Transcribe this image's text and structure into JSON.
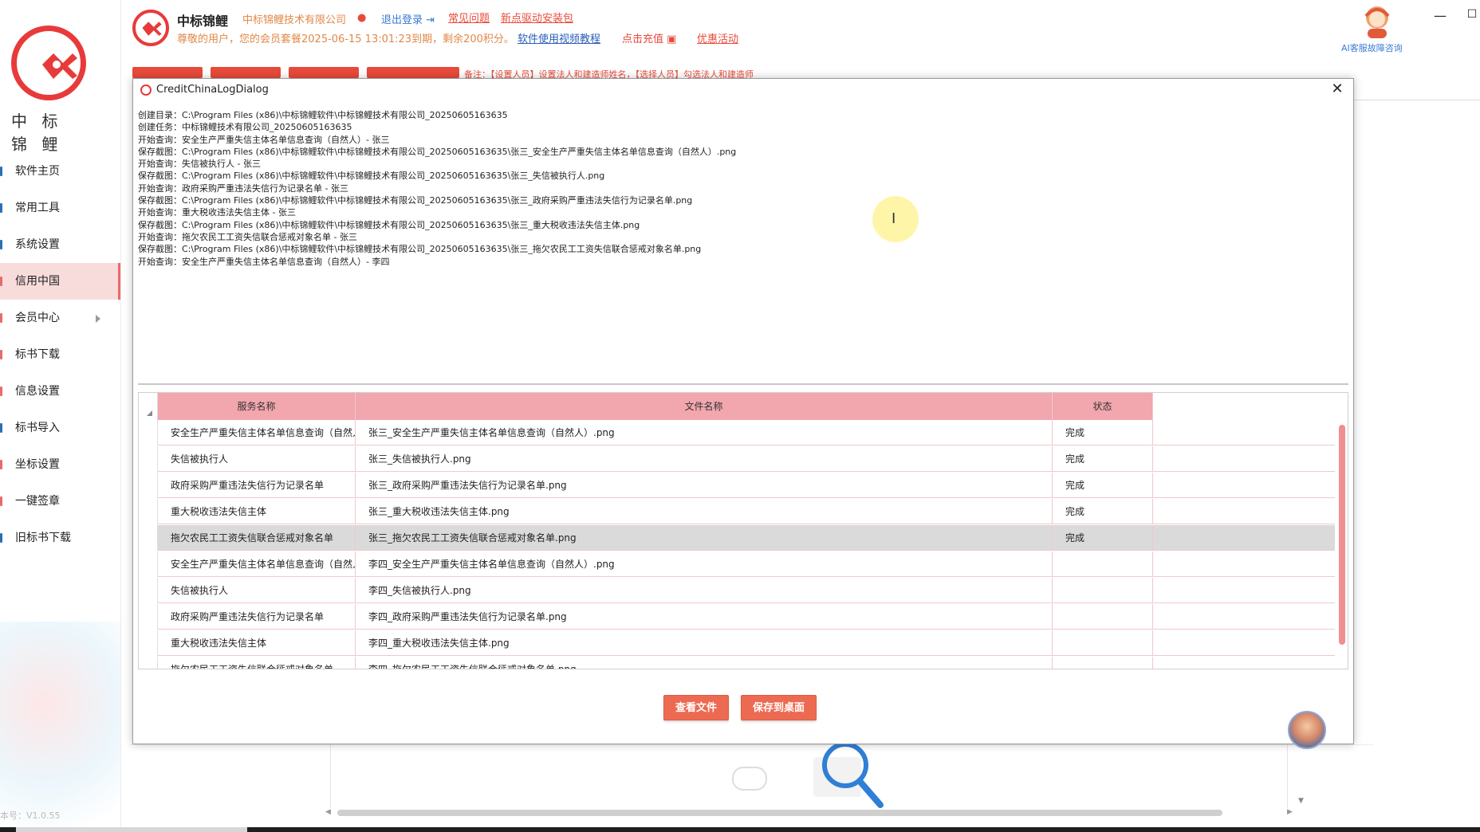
{
  "sidebar": {
    "brand": "中 标 锦 鲤",
    "items": [
      {
        "label": "软件主页"
      },
      {
        "label": "常用工具"
      },
      {
        "label": "系统设置"
      },
      {
        "label": "信用中国"
      },
      {
        "label": "会员中心"
      },
      {
        "label": "标书下载"
      },
      {
        "label": "信息设置"
      },
      {
        "label": "标书导入"
      },
      {
        "label": "坐标设置"
      },
      {
        "label": "一键签章"
      },
      {
        "label": "旧标书下载"
      }
    ],
    "active_index": 3,
    "version": "本号：V1.0.55"
  },
  "header": {
    "title": "中标锦鲤",
    "company": "中标锦鲤技术有限公司",
    "logout": "退出登录",
    "faq": "常见问题",
    "driver": "新点驱动安装包",
    "notice": "尊敬的用户，您的会员套餐2025-06-15 13:01:23到期，剩余200积分。",
    "video": "软件使用视频教程",
    "recharge": "点击充值",
    "promo": "优惠活动",
    "ai_service": "AI客服故障咨询"
  },
  "background": {
    "note": "备注：【设置人员】设置法人和建造师姓名，【选择人员】勾选法人和建造师"
  },
  "dialog": {
    "title": "CreditChinaLogDialog",
    "log_lines": [
      "创建目录：C:\\Program Files (x86)\\中标锦鲤软件\\中标锦鲤技术有限公司_20250605163635",
      "创建任务：中标锦鲤技术有限公司_20250605163635",
      "开始查询：安全生产严重失信主体名单信息查询（自然人）- 张三",
      "保存截图：C:\\Program Files (x86)\\中标锦鲤软件\\中标锦鲤技术有限公司_20250605163635\\张三_安全生产严重失信主体名单信息查询（自然人）.png",
      "开始查询：失信被执行人 - 张三",
      "保存截图：C:\\Program Files (x86)\\中标锦鲤软件\\中标锦鲤技术有限公司_20250605163635\\张三_失信被执行人.png",
      "开始查询：政府采购严重违法失信行为记录名单 - 张三",
      "保存截图：C:\\Program Files (x86)\\中标锦鲤软件\\中标锦鲤技术有限公司_20250605163635\\张三_政府采购严重违法失信行为记录名单.png",
      "开始查询：重大税收违法失信主体 - 张三",
      "保存截图：C:\\Program Files (x86)\\中标锦鲤软件\\中标锦鲤技术有限公司_20250605163635\\张三_重大税收违法失信主体.png",
      "开始查询：拖欠农民工工资失信联合惩戒对象名单 - 张三",
      "保存截图：C:\\Program Files (x86)\\中标锦鲤软件\\中标锦鲤技术有限公司_20250605163635\\张三_拖欠农民工工资失信联合惩戒对象名单.png",
      "开始查询：安全生产严重失信主体名单信息查询（自然人）- 李四"
    ],
    "table": {
      "columns": [
        "服务名称",
        "文件名称",
        "状态"
      ],
      "rows": [
        {
          "service": "安全生产严重失信主体名单信息查询（自然人）",
          "file": "张三_安全生产严重失信主体名单信息查询（自然人）.png",
          "status": "完成"
        },
        {
          "service": "失信被执行人",
          "file": "张三_失信被执行人.png",
          "status": "完成"
        },
        {
          "service": "政府采购严重违法失信行为记录名单",
          "file": "张三_政府采购严重违法失信行为记录名单.png",
          "status": "完成"
        },
        {
          "service": "重大税收违法失信主体",
          "file": "张三_重大税收违法失信主体.png",
          "status": "完成"
        },
        {
          "service": "拖欠农民工工资失信联合惩戒对象名单",
          "file": "张三_拖欠农民工工资失信联合惩戒对象名单.png",
          "status": "完成"
        },
        {
          "service": "安全生产严重失信主体名单信息查询（自然人）",
          "file": "李四_安全生产严重失信主体名单信息查询（自然人）.png",
          "status": ""
        },
        {
          "service": "失信被执行人",
          "file": "李四_失信被执行人.png",
          "status": ""
        },
        {
          "service": "政府采购严重违法失信行为记录名单",
          "file": "李四_政府采购严重违法失信行为记录名单.png",
          "status": ""
        },
        {
          "service": "重大税收违法失信主体",
          "file": "李四_重大税收违法失信主体.png",
          "status": ""
        },
        {
          "service": "拖欠农民工工资失信联合惩戒对象名单",
          "file": "李四_拖欠农民工工资失信联合惩戒对象名单.png",
          "status": ""
        }
      ],
      "selected_row": 4
    },
    "buttons": {
      "view_file": "查看文件",
      "save_desktop": "保存到桌面"
    }
  },
  "colors": {
    "brand_red": "#e83a3a",
    "header_pink": "#f2a6ad",
    "button_orange": "#ed6a52",
    "accent_orange": "#e0894a"
  }
}
